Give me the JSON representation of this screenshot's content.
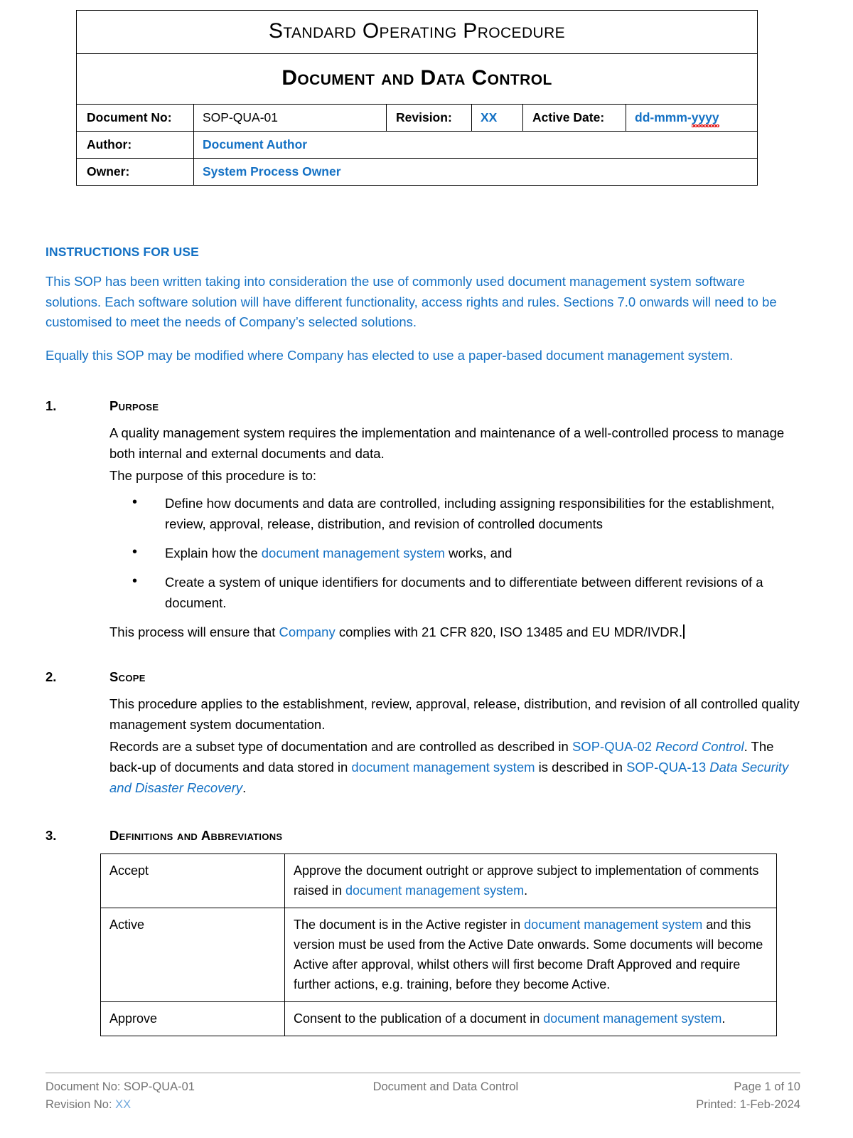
{
  "header": {
    "doc_type_title": "Standard Operating Procedure",
    "doc_title": "Document and Data Control",
    "fields": {
      "document_no_label": "Document No:",
      "document_no_value": "SOP-QUA-01",
      "revision_label": "Revision:",
      "revision_value": "XX",
      "active_date_label": "Active Date:",
      "active_date_value_prefix": "dd-mmm-",
      "active_date_value_misspelled": "yyyy",
      "author_label": "Author:",
      "author_value": "Document Author",
      "owner_label": "Owner:",
      "owner_value": "System Process Owner"
    }
  },
  "instructions": {
    "heading": "INSTRUCTIONS FOR USE",
    "paragraph_1": "This SOP has been written taking into consideration the use of commonly used document management system software solutions. Each software solution will have different functionality, access rights and rules. Sections 7.0 onwards will need to be customised to meet the needs of Company’s selected solutions.",
    "paragraph_2": "Equally this SOP may be modified where Company has elected to use a paper-based document management system."
  },
  "sections": {
    "purpose": {
      "number": "1.",
      "heading": "Purpose",
      "paragraph_1": "A quality management system requires the implementation and maintenance of a well-controlled process to manage both internal and external documents and data.",
      "paragraph_2": "The purpose of this procedure is to:",
      "bullets": [
        {
          "text_before": "Define how documents and data are controlled, including assigning responsibilities for the establishment, review, approval, release, distribution, and revision of controlled documents",
          "link": "",
          "text_after": ""
        },
        {
          "text_before": "Explain how the ",
          "link": "document management system",
          "text_after": " works, and"
        },
        {
          "text_before": "Create a system of unique identifiers for documents and to differentiate between different revisions of a document.",
          "link": "",
          "text_after": ""
        }
      ],
      "closing_before": "This process will ensure that ",
      "closing_link": "Company",
      "closing_after": " complies with 21 CFR 820, ISO 13485 and EU MDR/IVDR."
    },
    "scope": {
      "number": "2.",
      "heading": "Scope",
      "paragraph_1": "This procedure applies to the establishment, review, approval, release, distribution, and revision of all controlled quality management system documentation.",
      "p2_part1": "Records are a subset type of documentation and are controlled as described in ",
      "p2_ref1_code": "SOP-QUA-02",
      "p2_ref1_title": " Record Control",
      "p2_part2": ". The back-up of documents and data stored in ",
      "p2_link": "document management system",
      "p2_part3": " is described in ",
      "p2_ref2_code": "SOP-QUA-13",
      "p2_ref2_title": " Data Security and Disaster Recovery",
      "p2_part4": "."
    },
    "definitions": {
      "number": "3.",
      "heading": "Definitions and Abbreviations",
      "rows": [
        {
          "term": "Accept",
          "text_before": "Approve the document outright or approve subject to implementation of comments raised in ",
          "link": "document management system",
          "text_after": "."
        },
        {
          "term": "Active",
          "text_before": "The document is in the Active register in ",
          "link": "document management system",
          "text_after": " and this version must be used from the Active Date onwards. Some documents will become Active after approval, whilst others will first become Draft Approved and require further actions, e.g. training, before they become Active."
        },
        {
          "term": "Approve",
          "text_before": "Consent to the publication of a document in ",
          "link": "document management system",
          "text_after": "."
        }
      ]
    }
  },
  "footer": {
    "document_no": "Document No: SOP-QUA-01",
    "revision_no_label": "Revision No: ",
    "revision_no_value": "XX",
    "center_title": "Document and Data Control",
    "page_number": "Page 1 of 10",
    "printed": "Printed:  1-Feb-2024"
  },
  "colors": {
    "accent_blue": "#1471C4",
    "footer_gray": "#737373",
    "spellcheck_red": "#E00000"
  }
}
